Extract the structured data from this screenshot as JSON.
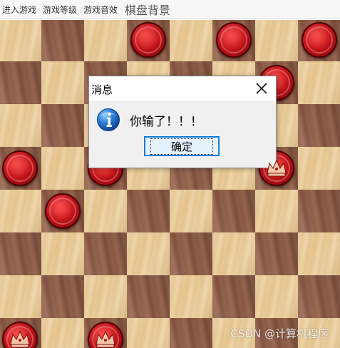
{
  "menu": {
    "items": [
      "进入游戏",
      "游戏等级",
      "游戏音效"
    ],
    "background_label": "棋盘背景"
  },
  "board": {
    "columns": 8,
    "colors": {
      "light": "#e8c995",
      "dark": "#8a5a45",
      "piece": "#c01218"
    },
    "pieces": [
      {
        "row": 0,
        "col": 3,
        "color": "red",
        "king": false
      },
      {
        "row": 0,
        "col": 5,
        "color": "red",
        "king": false
      },
      {
        "row": 0,
        "col": 7,
        "color": "red",
        "king": false
      },
      {
        "row": 1,
        "col": 6,
        "color": "red",
        "king": false
      },
      {
        "row": 3,
        "col": 0,
        "color": "red",
        "king": false
      },
      {
        "row": 3,
        "col": 2,
        "color": "red",
        "king": false
      },
      {
        "row": 3,
        "col": 6,
        "color": "red",
        "king": true
      },
      {
        "row": 4,
        "col": 1,
        "color": "red",
        "king": false
      },
      {
        "row": 7,
        "col": 0,
        "color": "red",
        "king": true
      },
      {
        "row": 7,
        "col": 2,
        "color": "red",
        "king": true
      }
    ]
  },
  "dialog": {
    "title": "消息",
    "message": "你输了！！！",
    "ok_label": "确定",
    "icon": "info-icon"
  },
  "watermark": "CSDN @计算机程序"
}
